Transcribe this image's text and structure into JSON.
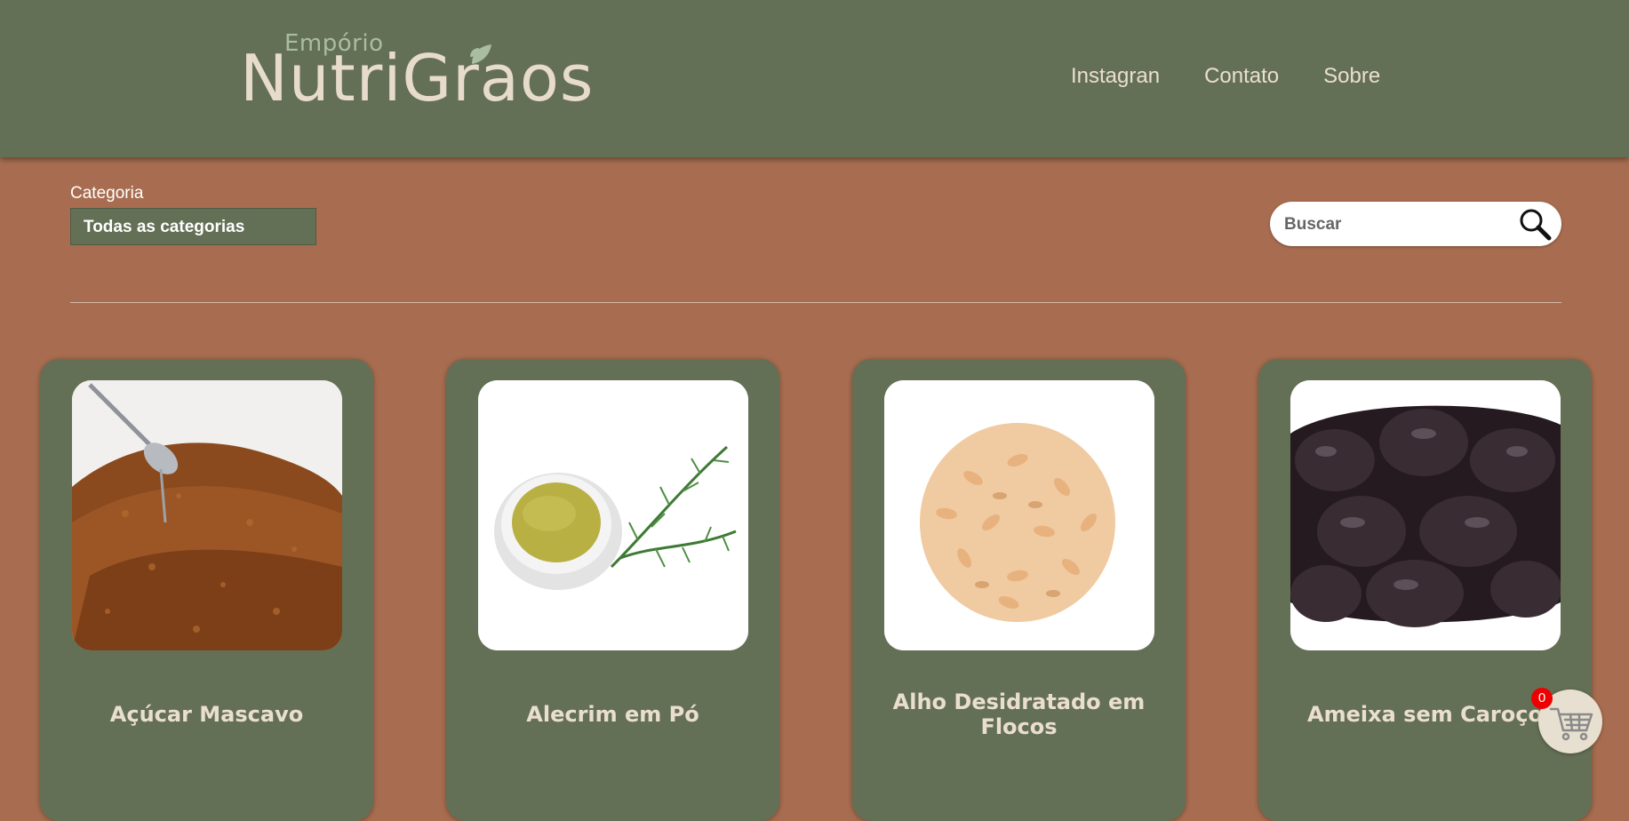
{
  "header": {
    "logo_top": "Empório",
    "logo_main": "NutriGraos",
    "nav": [
      {
        "label": "Instagran"
      },
      {
        "label": "Contato"
      },
      {
        "label": "Sobre"
      }
    ]
  },
  "filters": {
    "category_label": "Categoria",
    "category_selected": "Todas as categorias",
    "search_placeholder": "Buscar"
  },
  "products": [
    {
      "name": "Açúcar Mascavo"
    },
    {
      "name": "Alecrim em Pó"
    },
    {
      "name": "Alho Desidratado em Flocos"
    },
    {
      "name": "Ameixa sem Caroço"
    }
  ],
  "cart": {
    "count": "0"
  },
  "colors": {
    "header": "#647056",
    "background": "#a86d50",
    "card": "#647056",
    "text_light": "#eadfcf",
    "badge": "#ee0000"
  }
}
